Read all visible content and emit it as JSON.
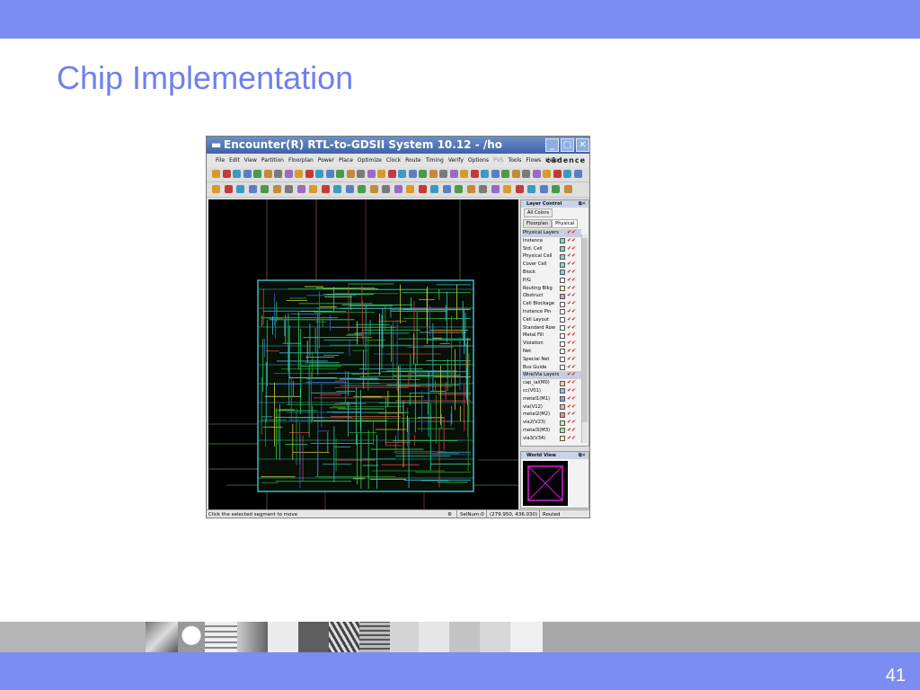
{
  "slide": {
    "title": "Chip Implementation",
    "page_number": "41",
    "colors": {
      "accent_bar": "#7b8cf2",
      "title_text": "#6f80ee"
    }
  },
  "window": {
    "title": "Encounter(R) RTL-to-GDSII System 10.12 - /ho",
    "controls": [
      "minimize-icon",
      "maximize-icon",
      "close-icon"
    ],
    "menu": [
      {
        "label": "File",
        "enabled": true
      },
      {
        "label": "Edit",
        "enabled": true
      },
      {
        "label": "View",
        "enabled": true
      },
      {
        "label": "Partition",
        "enabled": true
      },
      {
        "label": "Floorplan",
        "enabled": true
      },
      {
        "label": "Power",
        "enabled": true
      },
      {
        "label": "Place",
        "enabled": true
      },
      {
        "label": "Optimize",
        "enabled": true
      },
      {
        "label": "Clock",
        "enabled": true
      },
      {
        "label": "Route",
        "enabled": true
      },
      {
        "label": "Timing",
        "enabled": true
      },
      {
        "label": "Verify",
        "enabled": true
      },
      {
        "label": "Options",
        "enabled": true
      },
      {
        "label": "PVS",
        "enabled": false
      },
      {
        "label": "Tools",
        "enabled": true
      },
      {
        "label": "Flows",
        "enabled": true
      },
      {
        "label": "Help",
        "enabled": true
      }
    ],
    "brand": "cādence"
  },
  "layer_control": {
    "title": "Layer Control",
    "all_colors_label": "All Colors",
    "tabs": [
      {
        "label": "Floorplan",
        "active": false
      },
      {
        "label": "Physical",
        "active": true
      }
    ],
    "physical_section": "Physical Layers",
    "physical_layers": [
      {
        "name": "Instance",
        "color": "#7fd6d6"
      },
      {
        "name": "Std. Cell",
        "color": "#7fd6d6"
      },
      {
        "name": "Physical Cell",
        "color": "#7fd6d6"
      },
      {
        "name": "Cover Cell",
        "color": "#7fd6d6"
      },
      {
        "name": "Block",
        "color": "#7fd6d6"
      },
      {
        "name": "P/G",
        "color": "#ffffff"
      },
      {
        "name": "Routing Blkg",
        "color": "#f5f0a8"
      },
      {
        "name": "Obstruct",
        "color": "#e0a0a0"
      },
      {
        "name": "Cell Blockage",
        "color": "#ffffff"
      },
      {
        "name": "Instance Pin",
        "color": "#ffffff"
      },
      {
        "name": "Cell Layout",
        "color": "#ffffff"
      },
      {
        "name": "Standard Row",
        "color": "#ffffff"
      },
      {
        "name": "Metal Fill",
        "color": "#ffffff"
      },
      {
        "name": "Violation",
        "color": "#ffffff"
      },
      {
        "name": "Net",
        "color": "#ffffff"
      },
      {
        "name": "Special Net",
        "color": "#ffffff"
      },
      {
        "name": "Bus Guide",
        "color": "#ffffff"
      }
    ],
    "wire_section": "Wire/Via Layers",
    "wire_layers": [
      {
        "name": "cap_ial(M0)",
        "color": "#f6d0b0"
      },
      {
        "name": "cc(V01)",
        "color": "#a0b8f0"
      },
      {
        "name": "metal1(M1)",
        "color": "#8fa0e8"
      },
      {
        "name": "via(V12)",
        "color": "#f4b0b0"
      },
      {
        "name": "metal2(M2)",
        "color": "#f08c8c"
      },
      {
        "name": "via2(V23)",
        "color": "#b8f0b8"
      },
      {
        "name": "metal3(M3)",
        "color": "#a0e8a0"
      },
      {
        "name": "via3(V34)",
        "color": "#f0f0a0"
      }
    ]
  },
  "world_view": {
    "title": "World View"
  },
  "status_bar": {
    "message": "Click the selected segment to move",
    "selnum": "SelNum:0",
    "coords": "(279.950, 436.030)",
    "state": "Routed"
  }
}
